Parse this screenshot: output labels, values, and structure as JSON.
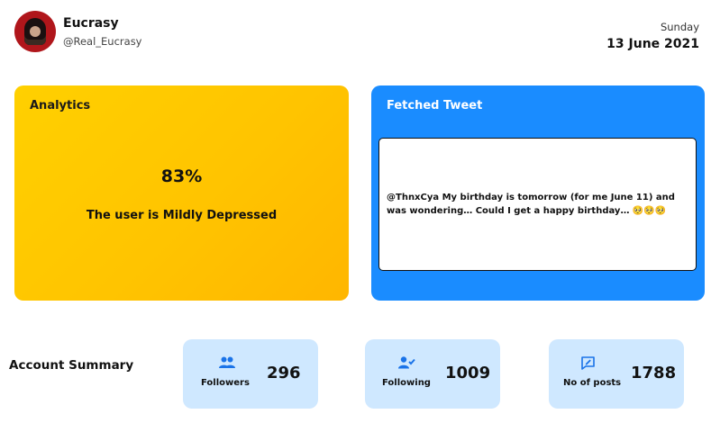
{
  "profile": {
    "name": "Eucrasy",
    "handle": "@Real_Eucrasy"
  },
  "date": {
    "day": "Sunday",
    "full": "13 June 2021"
  },
  "analytics": {
    "title": "Analytics",
    "percent": "83%",
    "verdict": "The user is Mildly Depressed",
    "colors": {
      "background": "#ffc400"
    }
  },
  "tweet": {
    "title": "Fetched Tweet",
    "text": "@ThnxCya My birthday is tomorrow (for me June 11) and was wondering… Could I get a happy birthday… 🥺🥺🥺",
    "colors": {
      "background": "#1a8cff"
    }
  },
  "summary": {
    "label": "Account Summary",
    "stats": [
      {
        "label": "Followers",
        "value": "296",
        "icon": "people-icon"
      },
      {
        "label": "Following",
        "value": "1009",
        "icon": "person-check-icon"
      },
      {
        "label": "No of posts",
        "value": "1788",
        "icon": "post-icon"
      }
    ],
    "colors": {
      "card": "#cfe8ff",
      "icon": "#1a73e8"
    }
  }
}
